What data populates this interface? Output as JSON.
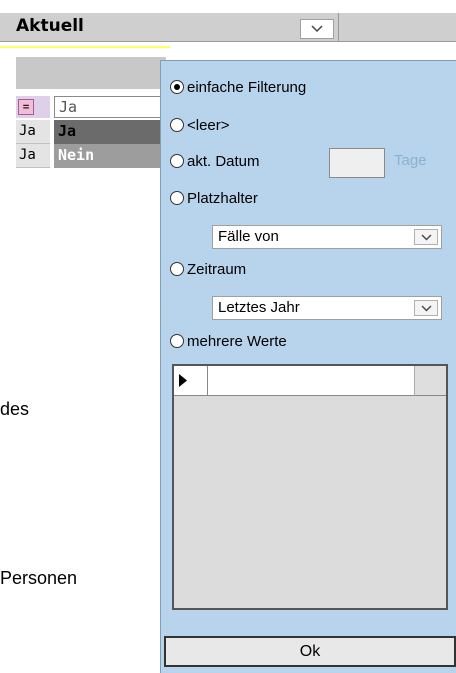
{
  "grid": {
    "column_title": "Aktuell",
    "filter_operator": "=",
    "filter_value": "Ja",
    "rows": [
      {
        "label": "Ja",
        "value": "Ja"
      },
      {
        "label": "Ja",
        "value": "Nein"
      }
    ]
  },
  "background_text": {
    "line1": "des",
    "line2": "Personen"
  },
  "filter_panel": {
    "options": {
      "simple": "einfache Filterung",
      "empty": "<leer>",
      "current_date": "akt. Datum",
      "placeholder": "Platzhalter",
      "period": "Zeitraum",
      "multiple": "mehrere Werte"
    },
    "selected_option": "einfache Filterung",
    "days_label": "Tage",
    "placeholder_select": "Fälle von",
    "period_select": "Letztes Jahr",
    "ok_label": "Ok"
  },
  "colors": {
    "panel_background": "#b8d4ec",
    "header_background": "#cfcfcf",
    "selected_row": "#6b6b6b"
  },
  "icons": {
    "dropdown": "chevron-down-icon",
    "row_pointer": "triangle-right-icon"
  }
}
